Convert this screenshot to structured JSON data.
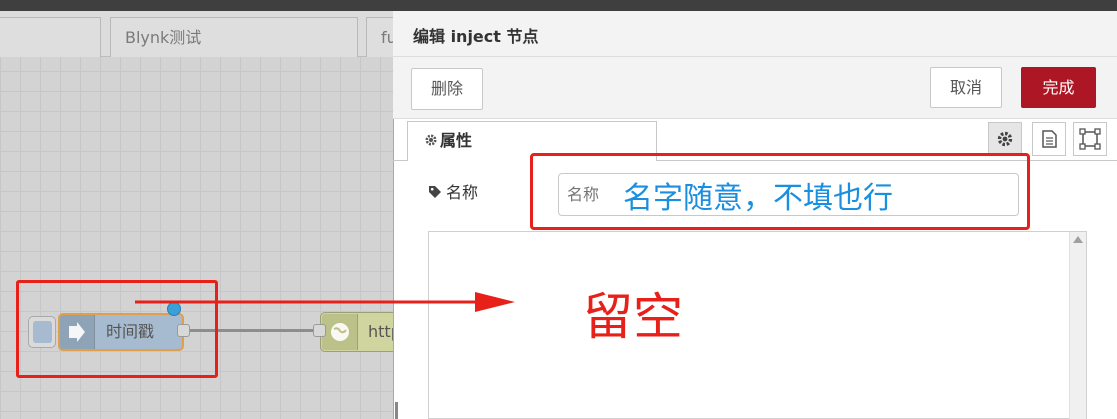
{
  "workspace": {
    "tabs": [
      "",
      "Blynk测试",
      "fu"
    ],
    "inject_node_label": "时间戳",
    "http_node_label": "http"
  },
  "tray": {
    "title": "编辑 inject 节点",
    "delete_label": "删除",
    "cancel_label": "取消",
    "done_label": "完成",
    "tab_label": "属性",
    "name_label": "名称",
    "name_placeholder": "名称",
    "name_value": ""
  },
  "annotations": {
    "name_hint": "名字随意，不填也行",
    "empty_hint": "留空"
  },
  "colors": {
    "done_button": "#ad1625",
    "annotation_red": "#e8201a",
    "annotation_blue": "#1a8fe0",
    "inject_node": "#a6bbcf",
    "http_node": "#d0d5a0"
  },
  "icons": [
    "gear-icon",
    "document-icon",
    "frame-icon",
    "tag-icon",
    "arrow-icon",
    "globe-icon"
  ]
}
